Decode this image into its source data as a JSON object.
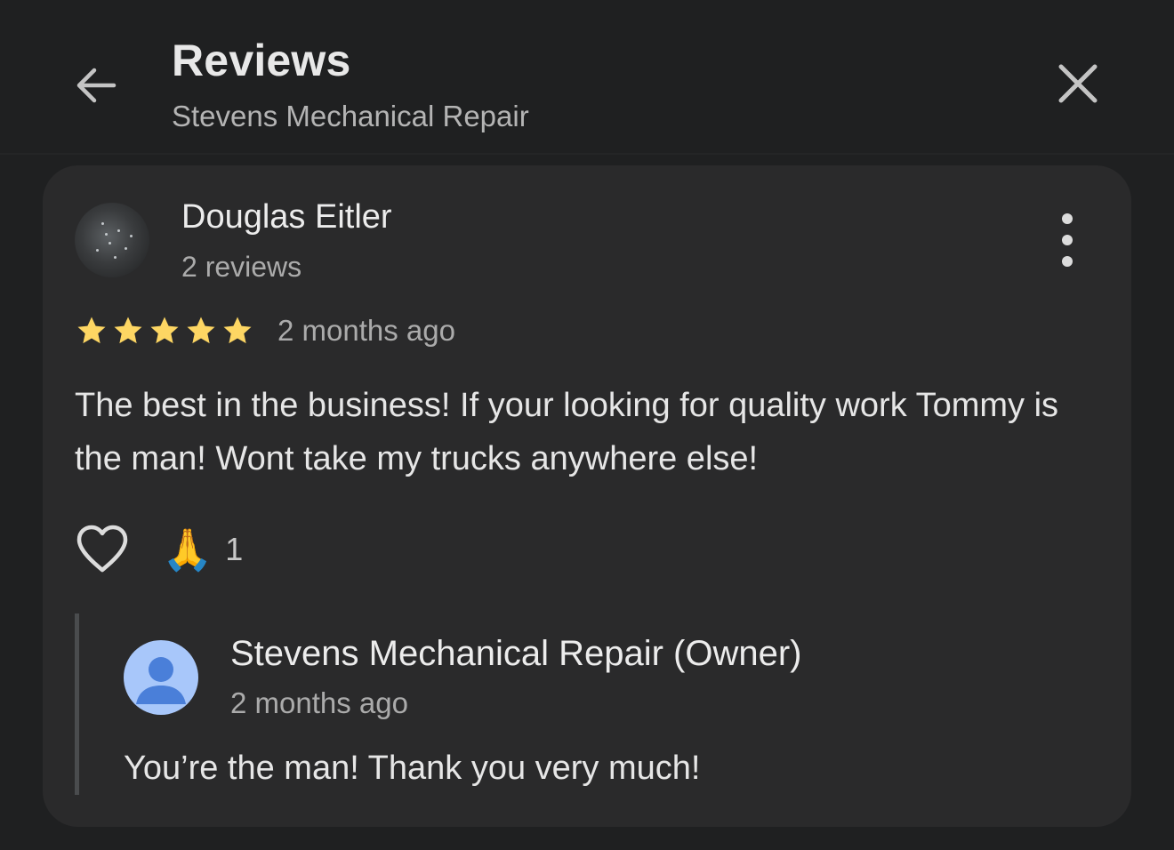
{
  "header": {
    "title": "Reviews",
    "subtitle": "Stevens Mechanical Repair",
    "back_icon": "arrow-back-icon",
    "close_icon": "close-icon"
  },
  "review": {
    "reviewer_name": "Douglas Eitler",
    "reviewer_meta": "2 reviews",
    "rating": 5,
    "max_rating": 5,
    "date": "2 months ago",
    "text": "The best in the business! If your looking for quality work Tommy is the man! Wont take my trucks anywhere else!",
    "more_icon": "more-vert-icon",
    "like_icon": "heart-outline-icon",
    "reaction_emoji": "🙏",
    "reaction_count": "1",
    "star_color": "#fdd663"
  },
  "owner_response": {
    "name": "Stevens Mechanical Repair (Owner)",
    "date": "2 months ago",
    "text": "You’re the man! Thank you very much!",
    "avatar_icon": "person-avatar-icon",
    "avatar_color": "#a8c7fa"
  }
}
